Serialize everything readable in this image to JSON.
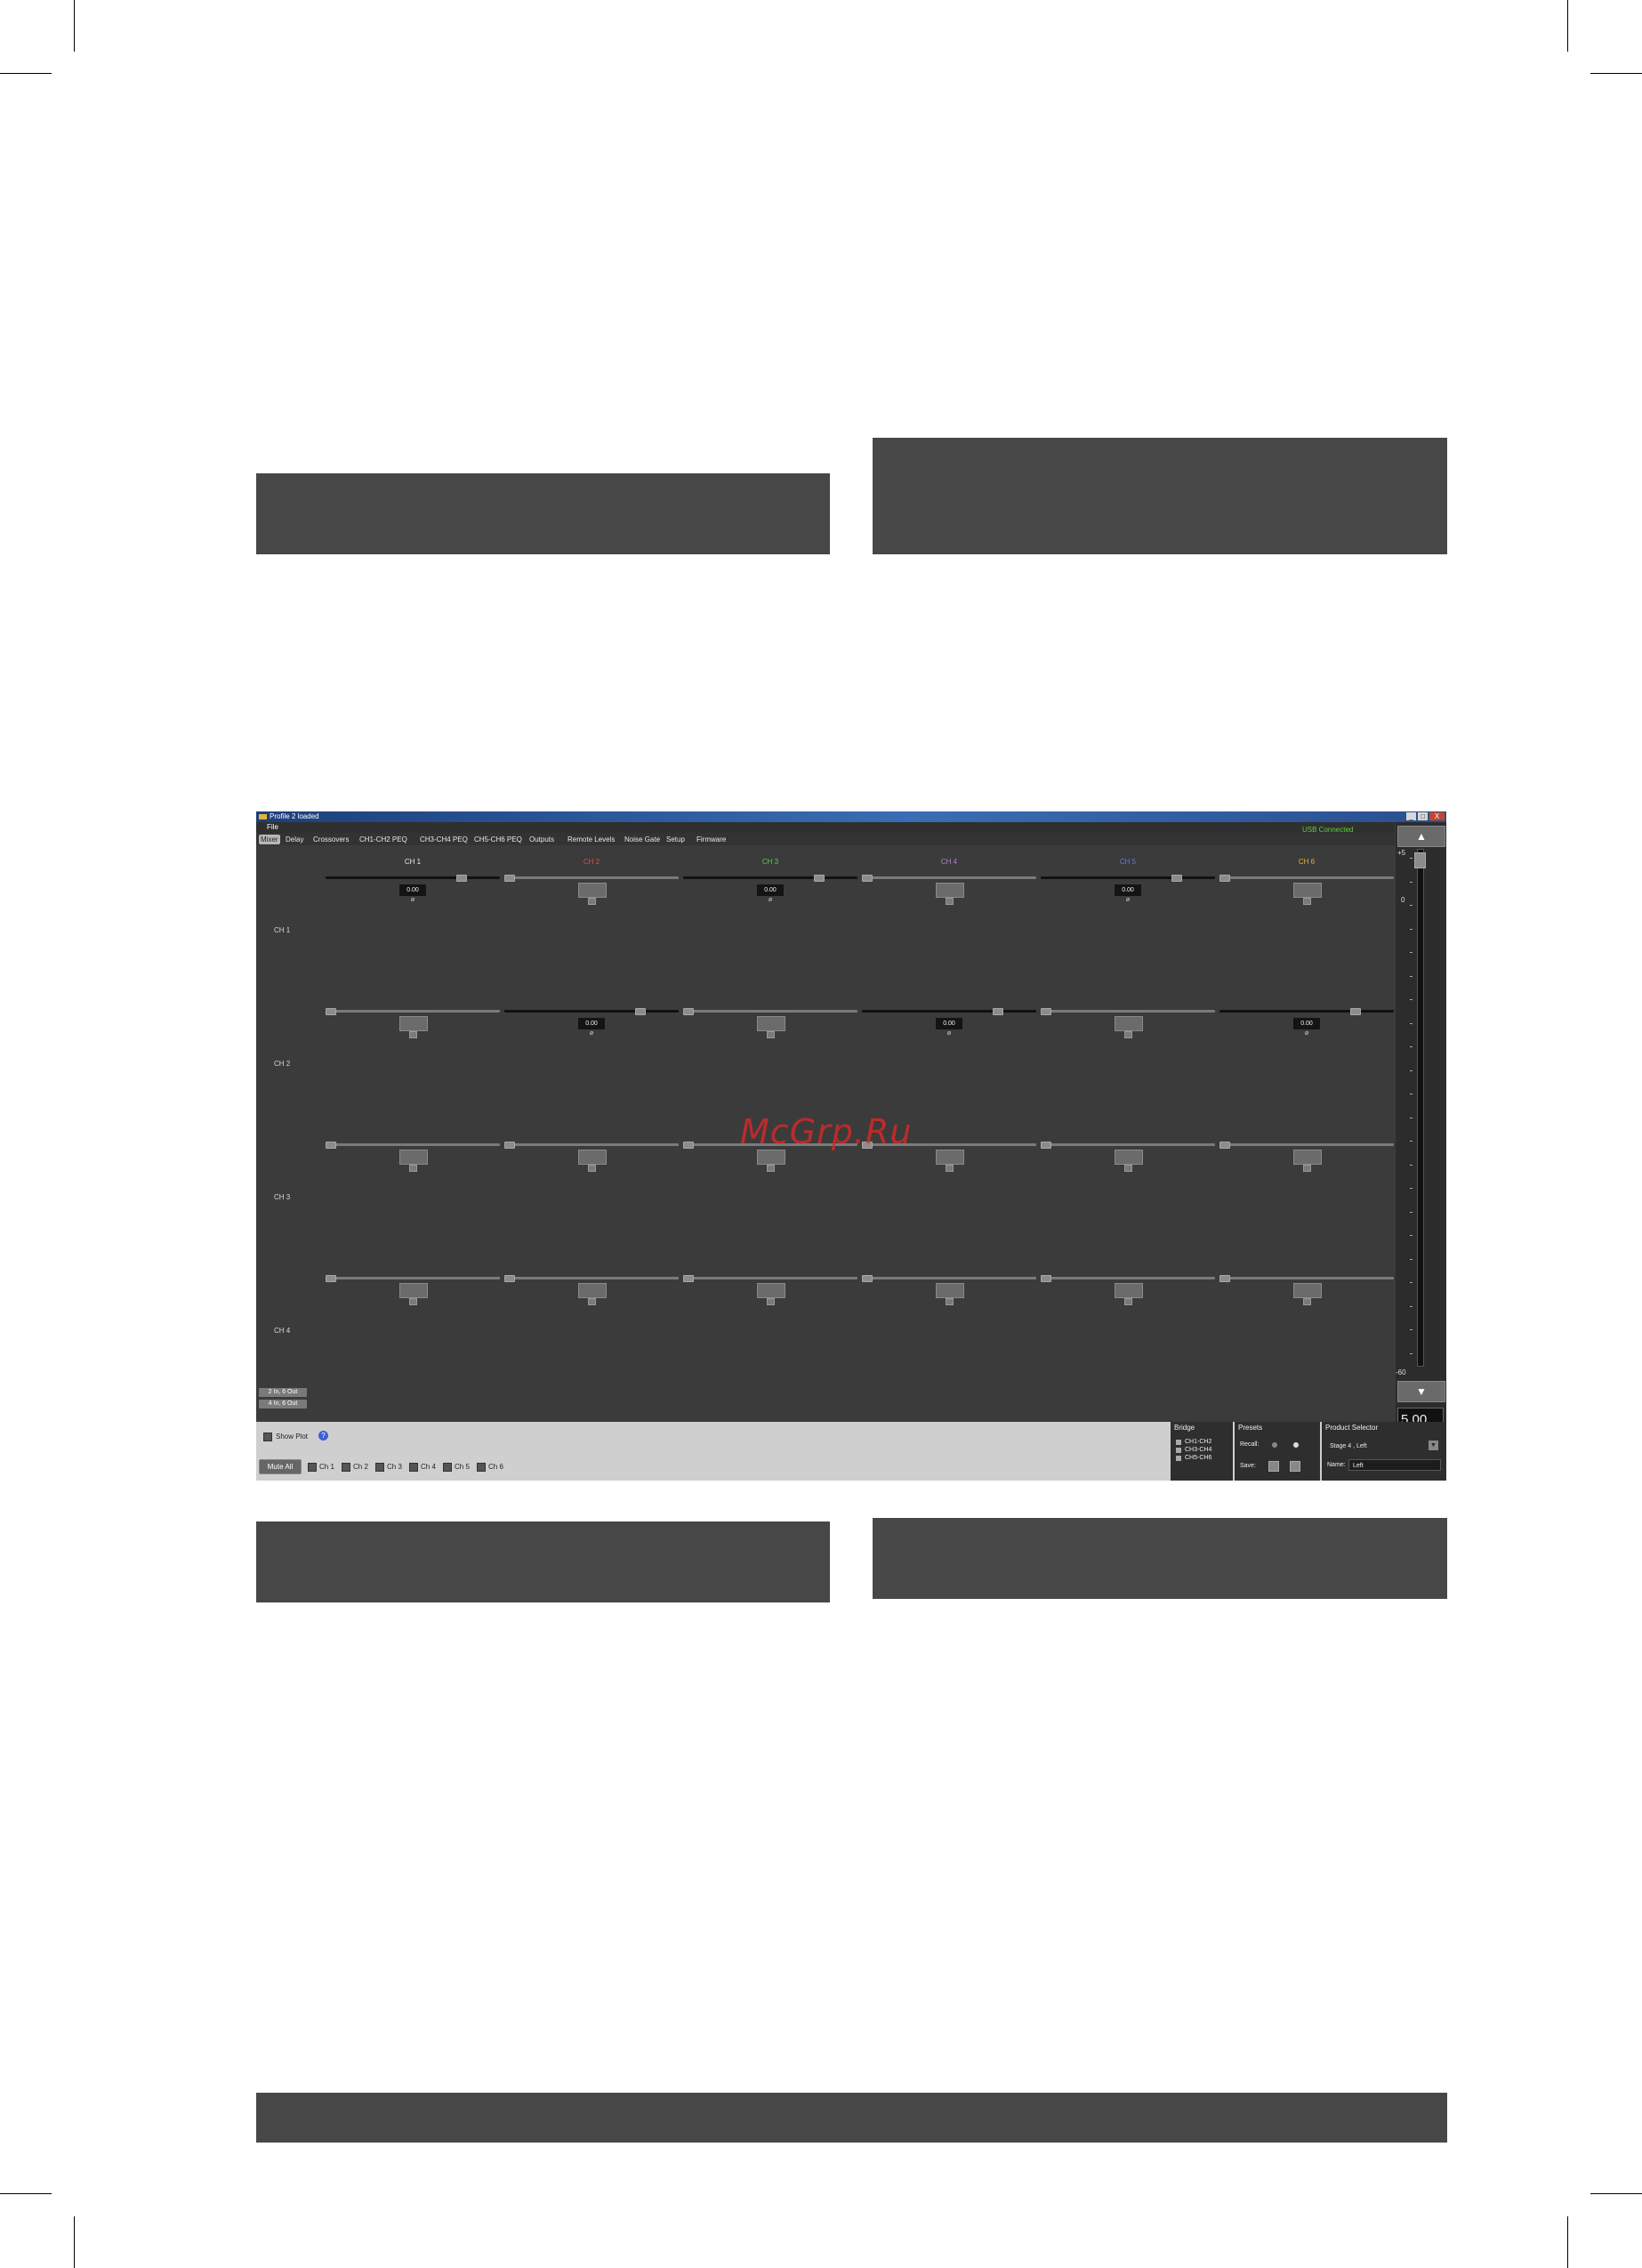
{
  "watermark": "McGrp.Ru",
  "window": {
    "title": "Profile 2 loaded",
    "menu_file": "File",
    "usb_status": "USB Connected",
    "controls": [
      "_",
      "□",
      "X"
    ]
  },
  "tabs": [
    {
      "label": "Mixer",
      "active": true
    },
    {
      "label": "Delay"
    },
    {
      "label": "Crossovers"
    },
    {
      "label": "CH1-CH2 PEQ"
    },
    {
      "label": "CH3-CH4 PEQ"
    },
    {
      "label": "CH5-CH6 PEQ"
    },
    {
      "label": "Outputs"
    },
    {
      "label": "Remote Levels"
    },
    {
      "label": "Noise Gate"
    },
    {
      "label": "Setup"
    },
    {
      "label": "Firmware"
    }
  ],
  "columns": [
    {
      "label": "CH 1",
      "color": "#e6e6e6"
    },
    {
      "label": "CH 2",
      "color": "#e8474a"
    },
    {
      "label": "CH 3",
      "color": "#4fd14a"
    },
    {
      "label": "CH 4",
      "color": "#b07ed8"
    },
    {
      "label": "CH 5",
      "color": "#5b7ce6"
    },
    {
      "label": "CH 6",
      "color": "#e0b53a"
    }
  ],
  "rows": [
    {
      "label": "CH 1",
      "cells": [
        {
          "active": true,
          "value": "0.00",
          "level": 0.8
        },
        {
          "active": false,
          "level": 0.0
        },
        {
          "active": true,
          "value": "0.00",
          "level": 0.8
        },
        {
          "active": false,
          "level": 0.0
        },
        {
          "active": true,
          "value": "0.00",
          "level": 0.8
        },
        {
          "active": false,
          "level": 0.0
        }
      ]
    },
    {
      "label": "CH 2",
      "cells": [
        {
          "active": false,
          "level": 0.0
        },
        {
          "active": true,
          "value": "0.00",
          "level": 0.8
        },
        {
          "active": false,
          "level": 0.0
        },
        {
          "active": true,
          "value": "0.00",
          "level": 0.8
        },
        {
          "active": false,
          "level": 0.0
        },
        {
          "active": true,
          "value": "0.00",
          "level": 0.8
        }
      ]
    },
    {
      "label": "CH 3",
      "cells": [
        {
          "active": false,
          "level": 0.0
        },
        {
          "active": false,
          "level": 0.0
        },
        {
          "active": false,
          "level": 0.0
        },
        {
          "active": false,
          "level": 0.0
        },
        {
          "active": false,
          "level": 0.0
        },
        {
          "active": false,
          "level": 0.0
        }
      ]
    },
    {
      "label": "CH 4",
      "cells": [
        {
          "active": false,
          "level": 0.0
        },
        {
          "active": false,
          "level": 0.0
        },
        {
          "active": false,
          "level": 0.0
        },
        {
          "active": false,
          "level": 0.0
        },
        {
          "active": false,
          "level": 0.0
        },
        {
          "active": false,
          "level": 0.0
        }
      ]
    }
  ],
  "meter": {
    "top_label": "+5",
    "zero_label": "0",
    "bottom_label": "-60",
    "value": "5.00",
    "up_arrow": "▲",
    "down_arrow": "▼"
  },
  "modes": [
    "2 In, 6 Out",
    "4 In, 6 Out"
  ],
  "bottom": {
    "show_plot": "Show Plot",
    "mute_all": "Mute All",
    "mute_channels": [
      "Ch 1",
      "Ch 2",
      "Ch 3",
      "Ch 4",
      "Ch 5",
      "Ch 6"
    ],
    "bridge": {
      "title": "Bridge",
      "items": [
        "CH1-CH2",
        "CH3-CH4",
        "CH5-CH6"
      ]
    },
    "presets": {
      "title": "Presets",
      "recall": "Recall:",
      "save": "Save:"
    },
    "product": {
      "title": "Product Selector",
      "selected": "Stage 4 , Left",
      "name_label": "Name:",
      "name_value": "Left"
    }
  }
}
